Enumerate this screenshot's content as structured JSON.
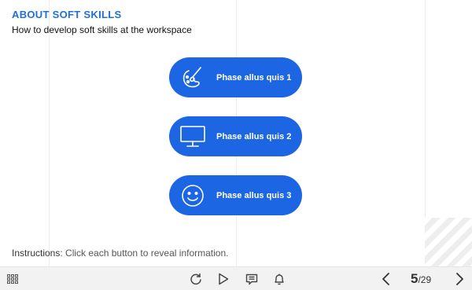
{
  "header": {
    "title": "ABOUT SOFT SKILLS",
    "subtitle": "How to develop soft skills at the workspace"
  },
  "buttons": [
    {
      "label": "Phase allus quis 1",
      "icon": "paintbrush-icon"
    },
    {
      "label": "Phase allus quis 2",
      "icon": "monitor-icon"
    },
    {
      "label": "Phase allus quis 3",
      "icon": "smiley-icon"
    }
  ],
  "instructions": {
    "prefix": "Instructions",
    "text": ": Click each button to reveal information."
  },
  "player": {
    "current_page": "5",
    "total_pages": "/29",
    "icons": [
      "menu-grid-icon",
      "replay-icon",
      "play-icon",
      "notes-icon",
      "bell-icon",
      "prev-arrow-icon",
      "next-arrow-icon"
    ]
  },
  "colors": {
    "accent": "#1d66e3",
    "title": "#1f6fd8",
    "toolbar": "#f2f2f2"
  }
}
